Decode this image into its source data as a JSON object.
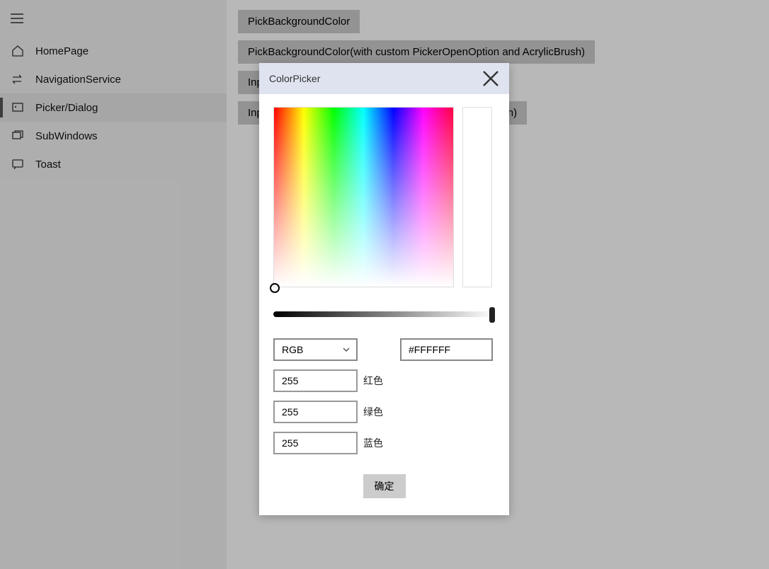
{
  "sidebar": {
    "items": [
      {
        "label": "HomePage"
      },
      {
        "label": "NavigationService"
      },
      {
        "label": "Picker/Dialog"
      },
      {
        "label": "SubWindows"
      },
      {
        "label": "Toast"
      }
    ],
    "active_index": 2
  },
  "main": {
    "buttons": [
      "PickBackgroundColor",
      "PickBackgroundColor(with custom PickerOpenOption and AcrylicBrush)",
      "Inp",
      "Inp                                                                              rush)"
    ]
  },
  "dialog": {
    "title": "ColorPicker",
    "mode_selected": "RGB",
    "hex_value": "#FFFFFF",
    "channels": {
      "r": {
        "value": "255",
        "label": "红色"
      },
      "g": {
        "value": "255",
        "label": "绿色"
      },
      "b": {
        "value": "255",
        "label": "蓝色"
      }
    },
    "confirm_label": "确定",
    "preview_color": "#FFFFFF"
  }
}
